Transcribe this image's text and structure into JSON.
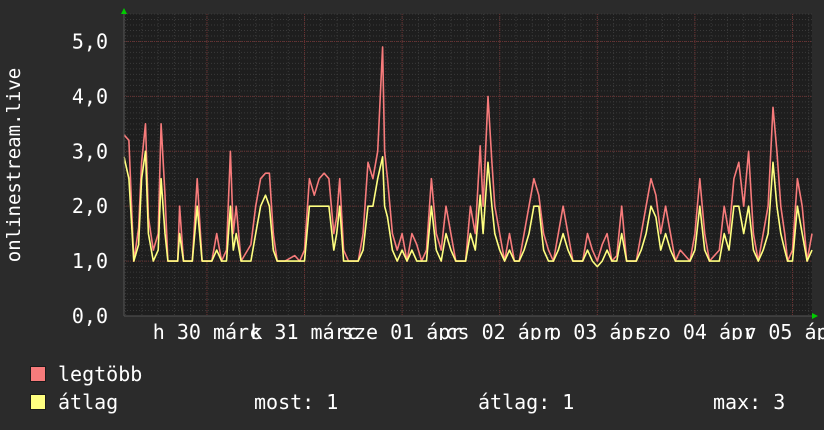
{
  "chart_data": {
    "type": "line",
    "ylabel": "onlinestream.live",
    "ylim": [
      0,
      5.5
    ],
    "y_ticks": [
      "0,0",
      "1,0",
      "2,0",
      "3,0",
      "4,0",
      "5,0"
    ],
    "y_tick_values": [
      0,
      1,
      2,
      3,
      4,
      5
    ],
    "x_ticks": [
      "h 30 márc",
      "k 31 márc",
      "sze 01 ápr",
      "cs 02 ápr",
      "p 03 ápr",
      "szo 04 ápr",
      "v 05 ápr"
    ],
    "x_tick_positions_days": [
      1,
      2,
      3,
      4,
      5,
      6,
      7
    ],
    "x_range_days": [
      0.15,
      7.2
    ],
    "grid": true,
    "legend_position": "bottom-left",
    "series": [
      {
        "name": "legtöbb",
        "color": "#f77b7b",
        "points": [
          [
            0.15,
            3.3
          ],
          [
            0.2,
            3.2
          ],
          [
            0.25,
            1.0
          ],
          [
            0.3,
            1.6
          ],
          [
            0.33,
            2.8
          ],
          [
            0.37,
            3.5
          ],
          [
            0.4,
            1.8
          ],
          [
            0.45,
            1.2
          ],
          [
            0.5,
            1.5
          ],
          [
            0.53,
            3.5
          ],
          [
            0.57,
            2.2
          ],
          [
            0.6,
            1.0
          ],
          [
            0.7,
            1.0
          ],
          [
            0.72,
            2.0
          ],
          [
            0.76,
            1.0
          ],
          [
            0.85,
            1.0
          ],
          [
            0.9,
            2.5
          ],
          [
            0.95,
            1.0
          ],
          [
            1.0,
            1.0
          ],
          [
            1.05,
            1.0
          ],
          [
            1.1,
            1.5
          ],
          [
            1.15,
            1.0
          ],
          [
            1.2,
            1.2
          ],
          [
            1.24,
            3.0
          ],
          [
            1.27,
            1.5
          ],
          [
            1.3,
            2.0
          ],
          [
            1.35,
            1.0
          ],
          [
            1.45,
            1.3
          ],
          [
            1.5,
            2.0
          ],
          [
            1.55,
            2.5
          ],
          [
            1.6,
            2.6
          ],
          [
            1.64,
            2.6
          ],
          [
            1.68,
            1.5
          ],
          [
            1.72,
            1.0
          ],
          [
            1.8,
            1.0
          ],
          [
            1.9,
            1.1
          ],
          [
            1.95,
            1.0
          ],
          [
            2.0,
            1.2
          ],
          [
            2.05,
            2.5
          ],
          [
            2.1,
            2.2
          ],
          [
            2.15,
            2.5
          ],
          [
            2.2,
            2.6
          ],
          [
            2.25,
            2.5
          ],
          [
            2.3,
            1.5
          ],
          [
            2.33,
            1.8
          ],
          [
            2.36,
            2.5
          ],
          [
            2.4,
            1.2
          ],
          [
            2.45,
            1.0
          ],
          [
            2.55,
            1.0
          ],
          [
            2.6,
            1.5
          ],
          [
            2.65,
            2.8
          ],
          [
            2.7,
            2.5
          ],
          [
            2.75,
            3.0
          ],
          [
            2.8,
            4.9
          ],
          [
            2.82,
            3.0
          ],
          [
            2.85,
            2.5
          ],
          [
            2.9,
            1.5
          ],
          [
            2.95,
            1.2
          ],
          [
            3.0,
            1.5
          ],
          [
            3.05,
            1.0
          ],
          [
            3.1,
            1.5
          ],
          [
            3.15,
            1.3
          ],
          [
            3.2,
            1.0
          ],
          [
            3.25,
            1.2
          ],
          [
            3.3,
            2.5
          ],
          [
            3.35,
            1.5
          ],
          [
            3.4,
            1.2
          ],
          [
            3.45,
            2.0
          ],
          [
            3.5,
            1.5
          ],
          [
            3.55,
            1.0
          ],
          [
            3.65,
            1.0
          ],
          [
            3.7,
            2.0
          ],
          [
            3.75,
            1.5
          ],
          [
            3.8,
            3.1
          ],
          [
            3.83,
            2.0
          ],
          [
            3.88,
            4.0
          ],
          [
            3.92,
            2.8
          ],
          [
            3.95,
            2.0
          ],
          [
            4.0,
            1.5
          ],
          [
            4.05,
            1.0
          ],
          [
            4.1,
            1.5
          ],
          [
            4.15,
            1.0
          ],
          [
            4.2,
            1.0
          ],
          [
            4.25,
            1.5
          ],
          [
            4.3,
            2.0
          ],
          [
            4.35,
            2.5
          ],
          [
            4.4,
            2.2
          ],
          [
            4.45,
            1.5
          ],
          [
            4.5,
            1.2
          ],
          [
            4.55,
            1.0
          ],
          [
            4.6,
            1.5
          ],
          [
            4.65,
            2.0
          ],
          [
            4.7,
            1.5
          ],
          [
            4.75,
            1.0
          ],
          [
            4.85,
            1.0
          ],
          [
            4.9,
            1.5
          ],
          [
            4.95,
            1.2
          ],
          [
            5.0,
            1.0
          ],
          [
            5.05,
            1.3
          ],
          [
            5.1,
            1.5
          ],
          [
            5.15,
            1.0
          ],
          [
            5.2,
            1.1
          ],
          [
            5.25,
            2.0
          ],
          [
            5.3,
            1.0
          ],
          [
            5.4,
            1.0
          ],
          [
            5.45,
            1.5
          ],
          [
            5.5,
            2.0
          ],
          [
            5.55,
            2.5
          ],
          [
            5.6,
            2.2
          ],
          [
            5.65,
            1.5
          ],
          [
            5.7,
            2.0
          ],
          [
            5.75,
            1.5
          ],
          [
            5.8,
            1.0
          ],
          [
            5.85,
            1.2
          ],
          [
            5.95,
            1.0
          ],
          [
            6.0,
            1.5
          ],
          [
            6.05,
            2.5
          ],
          [
            6.1,
            1.5
          ],
          [
            6.15,
            1.0
          ],
          [
            6.25,
            1.2
          ],
          [
            6.3,
            2.0
          ],
          [
            6.35,
            1.5
          ],
          [
            6.4,
            2.5
          ],
          [
            6.45,
            2.8
          ],
          [
            6.5,
            2.0
          ],
          [
            6.55,
            3.0
          ],
          [
            6.6,
            1.5
          ],
          [
            6.65,
            1.0
          ],
          [
            6.7,
            1.5
          ],
          [
            6.75,
            2.0
          ],
          [
            6.8,
            3.8
          ],
          [
            6.84,
            3.0
          ],
          [
            6.88,
            2.0
          ],
          [
            6.92,
            1.5
          ],
          [
            6.95,
            1.0
          ],
          [
            7.0,
            1.2
          ],
          [
            7.05,
            2.5
          ],
          [
            7.1,
            2.0
          ],
          [
            7.15,
            1.0
          ],
          [
            7.2,
            1.5
          ]
        ]
      },
      {
        "name": "átlag",
        "color": "#ffff80",
        "points": [
          [
            0.15,
            2.9
          ],
          [
            0.2,
            2.5
          ],
          [
            0.25,
            1.0
          ],
          [
            0.3,
            1.3
          ],
          [
            0.33,
            2.5
          ],
          [
            0.37,
            3.0
          ],
          [
            0.4,
            1.5
          ],
          [
            0.45,
            1.0
          ],
          [
            0.5,
            1.2
          ],
          [
            0.53,
            2.5
          ],
          [
            0.57,
            1.5
          ],
          [
            0.6,
            1.0
          ],
          [
            0.7,
            1.0
          ],
          [
            0.72,
            1.5
          ],
          [
            0.76,
            1.0
          ],
          [
            0.85,
            1.0
          ],
          [
            0.9,
            2.0
          ],
          [
            0.95,
            1.0
          ],
          [
            1.0,
            1.0
          ],
          [
            1.05,
            1.0
          ],
          [
            1.1,
            1.2
          ],
          [
            1.15,
            1.0
          ],
          [
            1.2,
            1.0
          ],
          [
            1.24,
            2.0
          ],
          [
            1.27,
            1.2
          ],
          [
            1.3,
            1.5
          ],
          [
            1.35,
            1.0
          ],
          [
            1.45,
            1.0
          ],
          [
            1.5,
            1.5
          ],
          [
            1.55,
            2.0
          ],
          [
            1.6,
            2.2
          ],
          [
            1.64,
            2.0
          ],
          [
            1.68,
            1.2
          ],
          [
            1.72,
            1.0
          ],
          [
            1.8,
            1.0
          ],
          [
            1.9,
            1.0
          ],
          [
            1.95,
            1.0
          ],
          [
            2.0,
            1.0
          ],
          [
            2.05,
            2.0
          ],
          [
            2.1,
            2.0
          ],
          [
            2.15,
            2.0
          ],
          [
            2.2,
            2.0
          ],
          [
            2.25,
            2.0
          ],
          [
            2.3,
            1.2
          ],
          [
            2.33,
            1.5
          ],
          [
            2.36,
            2.0
          ],
          [
            2.4,
            1.0
          ],
          [
            2.45,
            1.0
          ],
          [
            2.55,
            1.0
          ],
          [
            2.6,
            1.2
          ],
          [
            2.65,
            2.0
          ],
          [
            2.7,
            2.0
          ],
          [
            2.75,
            2.5
          ],
          [
            2.8,
            2.9
          ],
          [
            2.82,
            2.0
          ],
          [
            2.85,
            1.8
          ],
          [
            2.9,
            1.2
          ],
          [
            2.95,
            1.0
          ],
          [
            3.0,
            1.2
          ],
          [
            3.05,
            1.0
          ],
          [
            3.1,
            1.2
          ],
          [
            3.15,
            1.0
          ],
          [
            3.2,
            1.0
          ],
          [
            3.25,
            1.0
          ],
          [
            3.3,
            2.0
          ],
          [
            3.35,
            1.2
          ],
          [
            3.4,
            1.0
          ],
          [
            3.45,
            1.5
          ],
          [
            3.5,
            1.2
          ],
          [
            3.55,
            1.0
          ],
          [
            3.65,
            1.0
          ],
          [
            3.7,
            1.5
          ],
          [
            3.75,
            1.2
          ],
          [
            3.8,
            2.2
          ],
          [
            3.83,
            1.5
          ],
          [
            3.88,
            2.8
          ],
          [
            3.92,
            2.0
          ],
          [
            3.95,
            1.5
          ],
          [
            4.0,
            1.2
          ],
          [
            4.05,
            1.0
          ],
          [
            4.1,
            1.2
          ],
          [
            4.15,
            1.0
          ],
          [
            4.2,
            1.0
          ],
          [
            4.25,
            1.2
          ],
          [
            4.3,
            1.5
          ],
          [
            4.35,
            2.0
          ],
          [
            4.4,
            2.0
          ],
          [
            4.45,
            1.2
          ],
          [
            4.5,
            1.0
          ],
          [
            4.55,
            1.0
          ],
          [
            4.6,
            1.2
          ],
          [
            4.65,
            1.5
          ],
          [
            4.7,
            1.2
          ],
          [
            4.75,
            1.0
          ],
          [
            4.85,
            1.0
          ],
          [
            4.9,
            1.2
          ],
          [
            4.95,
            1.0
          ],
          [
            5.0,
            0.9
          ],
          [
            5.05,
            1.0
          ],
          [
            5.1,
            1.2
          ],
          [
            5.15,
            1.0
          ],
          [
            5.2,
            1.0
          ],
          [
            5.25,
            1.5
          ],
          [
            5.3,
            1.0
          ],
          [
            5.4,
            1.0
          ],
          [
            5.45,
            1.2
          ],
          [
            5.5,
            1.5
          ],
          [
            5.55,
            2.0
          ],
          [
            5.6,
            1.8
          ],
          [
            5.65,
            1.2
          ],
          [
            5.7,
            1.5
          ],
          [
            5.75,
            1.2
          ],
          [
            5.8,
            1.0
          ],
          [
            5.85,
            1.0
          ],
          [
            5.95,
            1.0
          ],
          [
            6.0,
            1.2
          ],
          [
            6.05,
            2.0
          ],
          [
            6.1,
            1.2
          ],
          [
            6.15,
            1.0
          ],
          [
            6.25,
            1.0
          ],
          [
            6.3,
            1.5
          ],
          [
            6.35,
            1.2
          ],
          [
            6.4,
            2.0
          ],
          [
            6.45,
            2.0
          ],
          [
            6.5,
            1.5
          ],
          [
            6.55,
            2.0
          ],
          [
            6.6,
            1.2
          ],
          [
            6.65,
            1.0
          ],
          [
            6.7,
            1.2
          ],
          [
            6.75,
            1.5
          ],
          [
            6.8,
            2.8
          ],
          [
            6.84,
            2.0
          ],
          [
            6.88,
            1.5
          ],
          [
            6.92,
            1.2
          ],
          [
            6.95,
            1.0
          ],
          [
            7.0,
            1.0
          ],
          [
            7.05,
            2.0
          ],
          [
            7.1,
            1.5
          ],
          [
            7.15,
            1.0
          ],
          [
            7.2,
            1.2
          ]
        ]
      }
    ]
  },
  "legend": {
    "max_label": "legtöbb",
    "avg_label": "átlag",
    "max_color": "#f77b7b",
    "avg_color": "#ffff80"
  },
  "stats": {
    "now": "most: 1",
    "avg": "átlag: 1",
    "max": "max: 3"
  }
}
